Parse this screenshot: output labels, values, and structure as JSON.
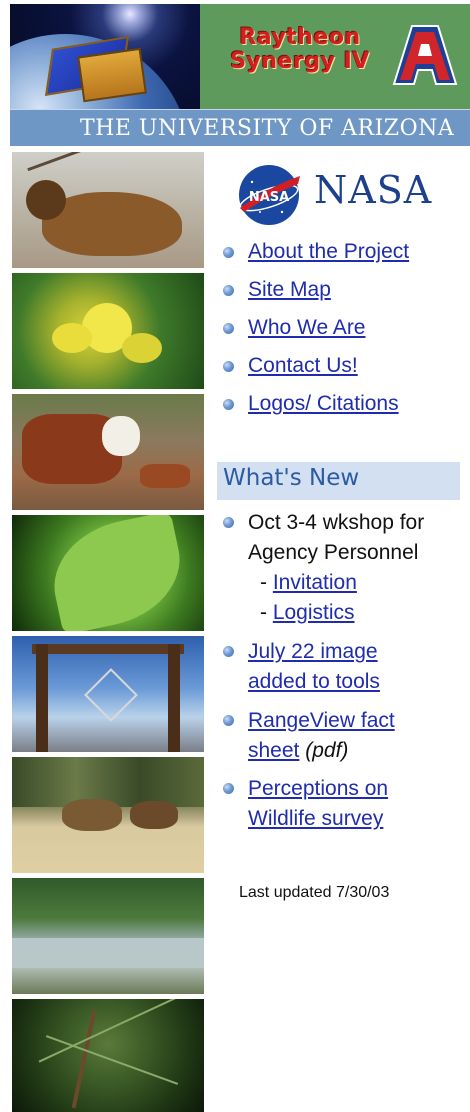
{
  "banner": {
    "title_line1": "Raytheon",
    "title_line2": "Synergy IV",
    "university": "THE UNIVERSITY OF ARIZONA",
    "logo_letter": "A"
  },
  "nasa": {
    "wordmark": "NASA",
    "meatball_text": "NASA"
  },
  "nav": {
    "items": [
      {
        "label": "About the Project"
      },
      {
        "label": "Site Map"
      },
      {
        "label": "Who We Are"
      },
      {
        "label": "Contact Us!"
      },
      {
        "label": "Logos/ Citations"
      }
    ]
  },
  "whats_new": {
    "title": "What's New",
    "item1": {
      "line1": "Oct 3-4 wkshop for",
      "line2": "Agency Personnel",
      "sub1_prefix": "- ",
      "sub1_link": "Invitation",
      "sub2_prefix": "- ",
      "sub2_link": "Logistics"
    },
    "item2": {
      "line1": "July 22 image",
      "line2": "added to tools"
    },
    "item3": {
      "line1": "RangeView fact",
      "line2": "sheet",
      "suffix": "(pdf)"
    },
    "item4": {
      "line1": "Perceptions on",
      "line2": "Wildlife survey"
    }
  },
  "footer": {
    "last_updated": "Last updated 7/30/03"
  },
  "colors": {
    "link": "#1f2cae",
    "nasa_blue": "#1c3f8e",
    "whats_new_bg": "#d3e0f1",
    "banner_green": "#5e9a5c",
    "banner_blue": "#6f97c6",
    "raytheon_red": "#d31f1f"
  },
  "icons": [
    "bullet-icon",
    "nasa-meatball-icon",
    "university-a-icon"
  ]
}
